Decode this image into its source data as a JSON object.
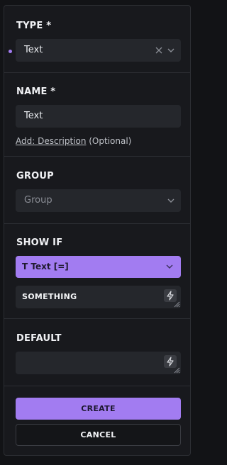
{
  "type": {
    "label": "TYPE *",
    "value": "Text"
  },
  "name": {
    "label": "NAME *",
    "value": "Text",
    "desc_link": "Add: Description",
    "desc_suffix": " (Optional)"
  },
  "group": {
    "label": "GROUP",
    "placeholder": "Group"
  },
  "show_if": {
    "label": "SHOW IF",
    "icon": "T",
    "condition": "Text [=]",
    "value": "SOMETHING"
  },
  "default": {
    "label": "DEFAULT",
    "value": ""
  },
  "actions": {
    "create": "CREATE",
    "cancel": "CANCEL"
  },
  "colors": {
    "accent": "#a27cf1",
    "field": "#25272c",
    "panel": "#18191d"
  }
}
